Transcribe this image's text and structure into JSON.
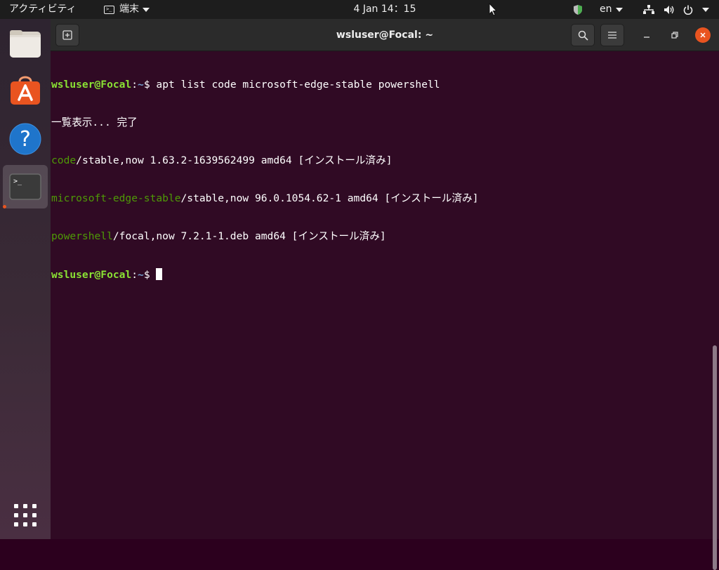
{
  "topbar": {
    "activities_label": "アクティビティ",
    "app_menu_label": "端末",
    "clock": "4 Jan 14：15",
    "language": "en"
  },
  "dock": {
    "items": [
      {
        "name": "files",
        "icon": "folder-icon"
      },
      {
        "name": "software",
        "icon": "shopping-bag-icon"
      },
      {
        "name": "help",
        "icon": "help-icon"
      },
      {
        "name": "terminal",
        "icon": "terminal-icon",
        "active": true
      }
    ],
    "show_apps_icon": "grid-icon"
  },
  "window": {
    "title": "wsluser@Focal: ~"
  },
  "terminal": {
    "prompt_user": "wsluser@Focal",
    "prompt_sep": ":",
    "prompt_path": "~",
    "prompt_dollar": "$ ",
    "command": "apt list code microsoft-edge-stable powershell",
    "listing_line": "一覧表示... 完了",
    "results": [
      {
        "pkg": "code",
        "rest": "/stable,now 1.63.2-1639562499 amd64 [インストール済み]"
      },
      {
        "pkg": "microsoft-edge-stable",
        "rest": "/stable,now 96.0.1054.62-1 amd64 [インストール済み]"
      },
      {
        "pkg": "powershell",
        "rest": "/focal,now 7.2.1-1.deb amd64 [インストール済み]"
      }
    ]
  },
  "colors": {
    "terminal_bg": "#300a24",
    "prompt_user": "#8ae234",
    "prompt_path": "#729fcf",
    "package_name": "#4e9a06",
    "close_button": "#e95420"
  }
}
